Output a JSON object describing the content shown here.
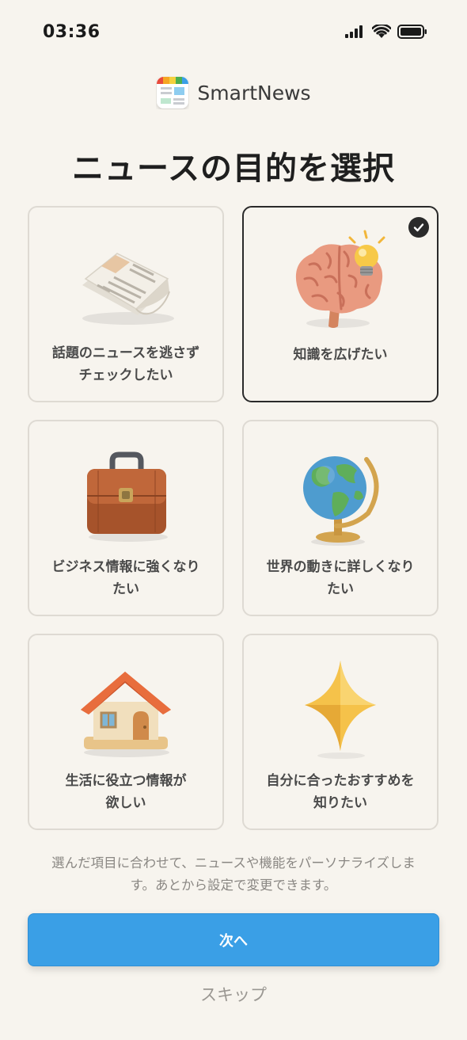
{
  "status_bar": {
    "time": "03:36",
    "icons": [
      "signal-icon",
      "wifi-icon",
      "battery-icon"
    ]
  },
  "header": {
    "brand": "SmartNews",
    "title": "ニュースの目的を選択"
  },
  "options": [
    {
      "label": "話題のニュースを逃さずチェックしたい",
      "lines": [
        "話題のニュースを逃さず",
        "チェックしたい"
      ],
      "icon": "newspaper-icon",
      "selected": false
    },
    {
      "label": "知識を広げたい",
      "lines": [
        "知識を広げたい"
      ],
      "icon": "brain-lightbulb-icon",
      "selected": true
    },
    {
      "label": "ビジネス情報に強くなりたい",
      "lines": [
        "ビジネス情報に強くなり",
        "たい"
      ],
      "icon": "briefcase-icon",
      "selected": false
    },
    {
      "label": "世界の動きに詳しくなりたい",
      "lines": [
        "世界の動きに詳しくなり",
        "たい"
      ],
      "icon": "globe-icon",
      "selected": false
    },
    {
      "label": "生活に役立つ情報が欲しい",
      "lines": [
        "生活に役立つ情報が",
        "欲しい"
      ],
      "icon": "house-icon",
      "selected": false
    },
    {
      "label": "自分に合ったおすすめを知りたい",
      "lines": [
        "自分に合ったおすすめを",
        "知りたい"
      ],
      "icon": "sparkle-icon",
      "selected": false
    }
  ],
  "footnote": {
    "line1": "選んだ項目に合わせて、ニュースや機能をパーソナライズしま",
    "line2": "す。あとから設定で変更できます。"
  },
  "actions": {
    "next_label": "次へ",
    "skip_label": "スキップ"
  },
  "colors": {
    "background": "#f7f4ee",
    "accent": "#3a9fe6",
    "selected_border": "#2a2a2a"
  }
}
